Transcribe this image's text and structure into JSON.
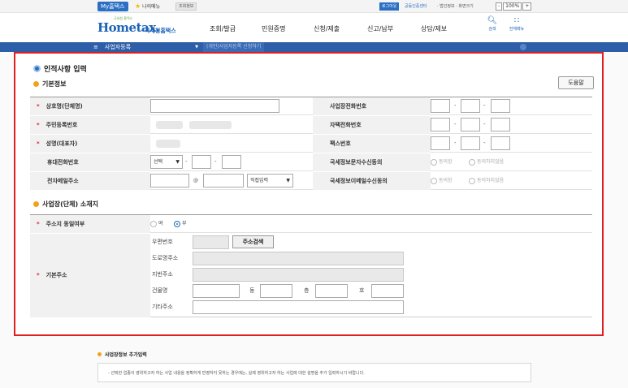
{
  "topbar": {
    "my_tax": "My홈택스",
    "my_service": "나의메뉴",
    "tax_info": "조회정보",
    "logout": "로그아웃",
    "cert_center": "공동인증센터",
    "user_links": "· 법인정보 · 화면크기",
    "zoom_minus": "-",
    "zoom_value": "100%",
    "zoom_plus": "+"
  },
  "header": {
    "logo_small": "국세청 홈택스",
    "logo_main": "Hometax.",
    "logo_sub": "국세청홈택스",
    "gnb": [
      "조회/발급",
      "민원증명",
      "신청/제출",
      "신고/납부",
      "상담/제보"
    ],
    "search_label": "검색",
    "allmenu_label": "전체메뉴"
  },
  "nav": {
    "menu_label": "사업자등록",
    "crumb": "(개인)사업자등록 신청하기"
  },
  "form": {
    "section_title": "인적사항 입력",
    "basic_info_title": "기본정보",
    "help_button": "도움말",
    "required_mark": "*",
    "rows": {
      "trade_name": "상호명(단체명)",
      "resident_no": "주민등록번호",
      "name": "성명(대표자)",
      "mobile": "휴대전화번호",
      "email": "전자메일주소",
      "biz_phone": "사업장전화번호",
      "home_phone": "자택전화번호",
      "fax": "팩스번호",
      "sms_consent": "국세정보문자수신동의",
      "email_consent": "국세정보이메일수신동의"
    },
    "mobile_select": "선택",
    "email_at": "@",
    "email_domain_select": "직접입력",
    "agree_label": "동의함",
    "disagree_label": "동의하지않음",
    "address_section_title": "사업장(단체) 소재지",
    "same_address_label": "주소지 동일여부",
    "yes_label": "여",
    "no_label": "부",
    "base_address_label": "기본주소",
    "postal_label": "우편번호",
    "address_search_button": "주소검색",
    "road_label": "도로명주소",
    "lot_label": "지번주소",
    "building_label": "건물명",
    "dong_label": "동",
    "floor_label": "층",
    "ho_label": "호",
    "other_label": "기타주소"
  },
  "extra": {
    "title": "사업장정보 추가입력",
    "notice": "- 선택한 업종이 영위하고자 하는 사업 내용을 정확하게 반영하지 못하는 경우에는, 실제 영위하고자 하는 사업에 대한 설명을 추가 입력하시기 바랍니다."
  }
}
